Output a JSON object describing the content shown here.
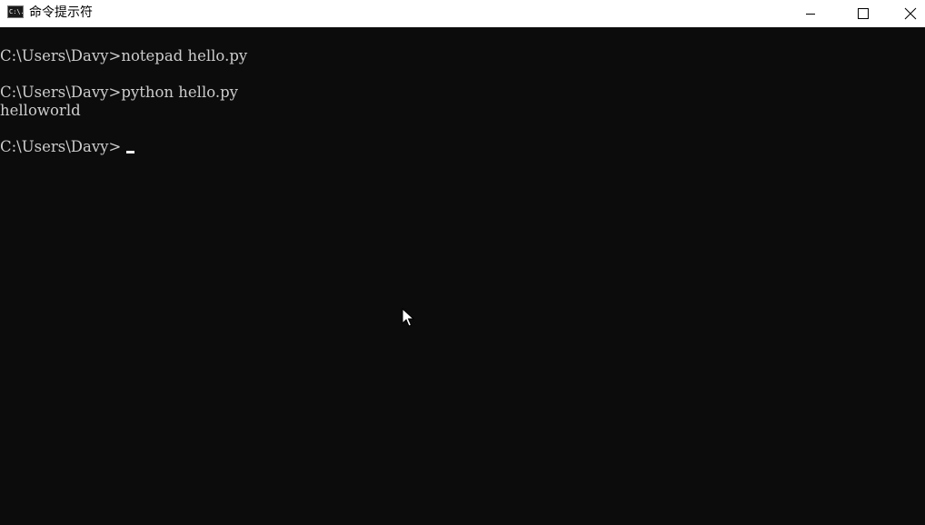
{
  "window": {
    "title": "命令提示符",
    "icon_label": "C:\\.",
    "icon_name": "cmd-icon"
  },
  "controls": {
    "minimize_icon": "minimize-icon",
    "maximize_icon": "maximize-icon",
    "close_icon": "close-icon"
  },
  "console": {
    "lines": [
      "C:\\Users\\Davy>notepad hello.py",
      "C:\\Users\\Davy>python hello.py",
      "helloworld",
      "C:\\Users\\Davy>"
    ]
  },
  "colors": {
    "background": "#0c0c0c",
    "text": "#cccccc",
    "titlebar": "#ffffff"
  }
}
